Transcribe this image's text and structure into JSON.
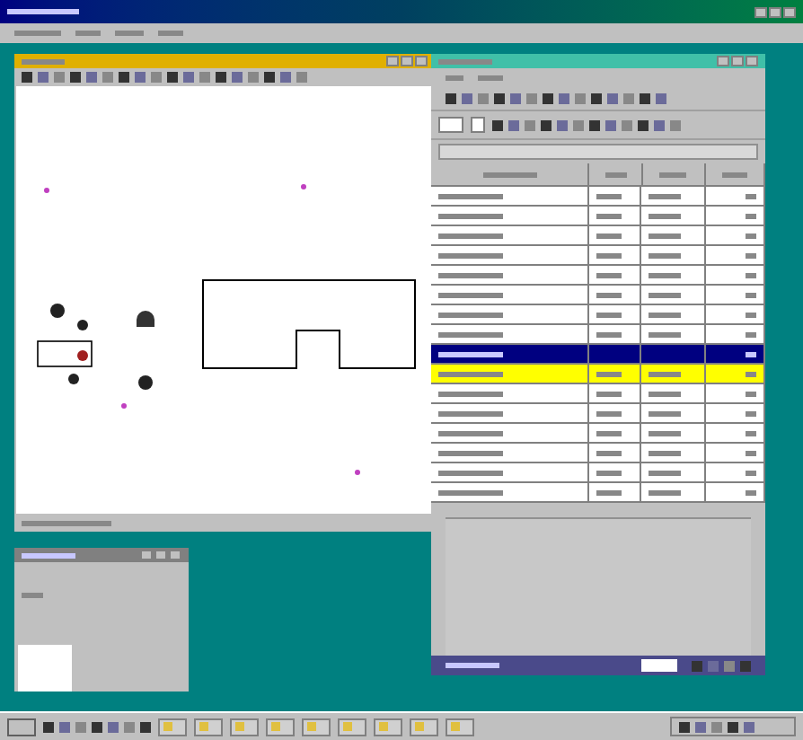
{
  "main_window": {
    "active": true
  },
  "canvas_window": {
    "active": true
  },
  "table_window": {
    "active": false
  },
  "table": {
    "rows": [
      {
        "selected": false,
        "flagged": false
      },
      {
        "selected": false,
        "flagged": false
      },
      {
        "selected": false,
        "flagged": false
      },
      {
        "selected": false,
        "flagged": false
      },
      {
        "selected": false,
        "flagged": false
      },
      {
        "selected": false,
        "flagged": false
      },
      {
        "selected": false,
        "flagged": false
      },
      {
        "selected": false,
        "flagged": false
      },
      {
        "selected": true,
        "flagged": false
      },
      {
        "selected": false,
        "flagged": true
      },
      {
        "selected": false,
        "flagged": false
      },
      {
        "selected": false,
        "flagged": false
      },
      {
        "selected": false,
        "flagged": false
      },
      {
        "selected": false,
        "flagged": false
      },
      {
        "selected": false,
        "flagged": false
      },
      {
        "selected": false,
        "flagged": false
      }
    ]
  }
}
